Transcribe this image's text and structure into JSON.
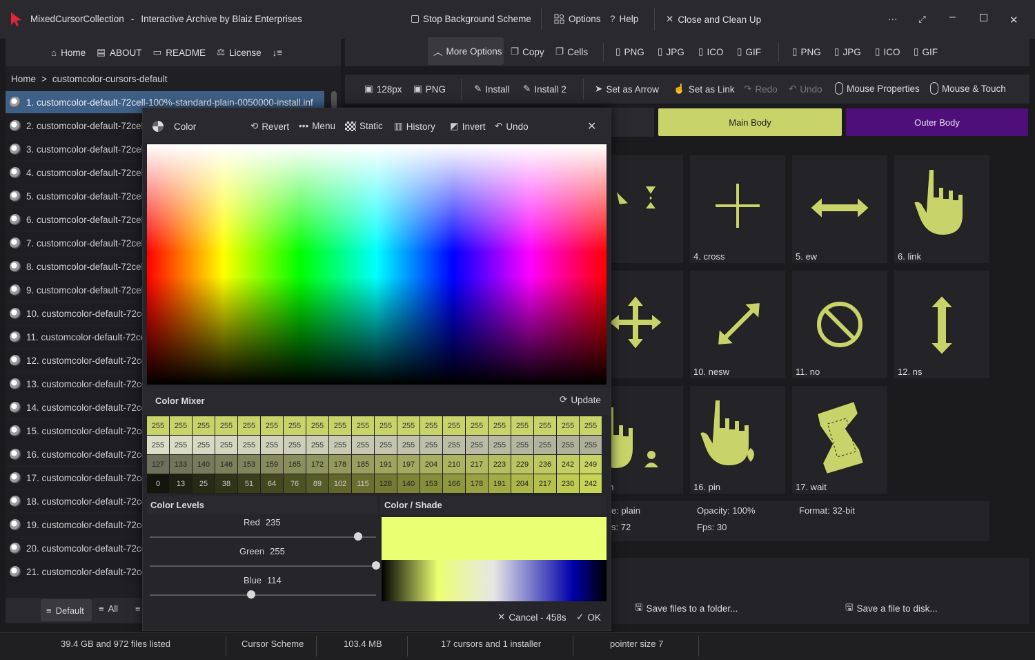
{
  "window": {
    "app_name": "MixedCursorCollection",
    "title_suffix": "Interactive Archive by Blaiz Enterprises",
    "dash": "-",
    "stop_bg": "Stop Background Scheme",
    "options": "Options",
    "help": "Help",
    "close_clean": "Close and Clean Up",
    "dots": "···"
  },
  "nav": {
    "home": "Home",
    "about": "ABOUT",
    "readme": "README",
    "license": "License",
    "sort": "↓≡"
  },
  "breadcrumb": {
    "root": "Home",
    "sep": ">",
    "current": "customcolor-cursors-default"
  },
  "list": [
    "1. customcolor-default-72cell-100%-standard-plain-0050000-install.inf",
    "2. customcolor-default-72cell-",
    "3. customcolor-default-72cell-",
    "4. customcolor-default-72cell-",
    "5. customcolor-default-72cell-",
    "6. customcolor-default-72cell-",
    "7. customcolor-default-72cell-",
    "8. customcolor-default-72cell-",
    "9. customcolor-default-72cell-",
    "10. customcolor-default-72cel",
    "11. customcolor-default-72cel",
    "12. customcolor-default-72cel",
    "13. customcolor-default-72cel",
    "14. customcolor-default-72cel",
    "15. customcolor-default-72cel",
    "16. customcolor-default-72cel",
    "17. customcolor-default-72cel",
    "18. customcolor-default-72cel",
    "19. customcolor-default-72cel",
    "20. customcolor-default-72cel",
    "21. customcolor-default-72cel"
  ],
  "list_footer": {
    "default": "Default",
    "all": "All"
  },
  "toolbar1": {
    "more_options": "More Options",
    "copy": "Copy",
    "cells": "Cells",
    "png1": "PNG",
    "jpg1": "JPG",
    "ico1": "ICO",
    "gif1": "GIF",
    "png2": "PNG",
    "jpg2": "JPG",
    "ico2": "ICO",
    "gif2": "GIF"
  },
  "toolbar2": {
    "size": "128px",
    "png": "PNG",
    "install": "Install",
    "install2": "Install 2",
    "set_arrow": "Set as Arrow",
    "set_link": "Set as Link",
    "redo": "Redo",
    "undo": "Undo",
    "mouse_props": "Mouse Properties",
    "mouse_touch": "Mouse & Touch"
  },
  "body_tabs": {
    "main": "Main Body",
    "outer": "Outer Body"
  },
  "cells": [
    {
      "label": "rk",
      "icon": "working-cursor-icon"
    },
    {
      "label": "4. cross",
      "icon": "cross-cursor-icon"
    },
    {
      "label": "5. ew",
      "icon": "ew-arrow-icon"
    },
    {
      "label": "6. link",
      "icon": "hand-link-icon"
    },
    {
      "label": "ove",
      "icon": "move-cursor-icon"
    },
    {
      "label": "10. nesw",
      "icon": "nesw-arrow-icon"
    },
    {
      "label": "11. no",
      "icon": "no-cursor-icon"
    },
    {
      "label": "12. ns",
      "icon": "ns-arrow-icon"
    },
    {
      "label": "erson",
      "icon": "person-hand-icon"
    },
    {
      "label": "16. pin",
      "icon": "pin-hand-icon"
    },
    {
      "label": "17. wait",
      "icon": "hourglass-icon"
    }
  ],
  "info": {
    "style": "e: plain",
    "size": "s: 72",
    "opacity": "Opacity: 100%",
    "fps": "Fps: 30",
    "format": "Format: 32-bit"
  },
  "save": {
    "folder": "Save files to a folder...",
    "disk": "Save a file to disk..."
  },
  "dialog": {
    "title": "Color",
    "revert": "Revert",
    "menu": "Menu",
    "static": "Static",
    "history": "History",
    "invert": "Invert",
    "undo": "Undo",
    "mixer_title": "Color Mixer",
    "update": "Update",
    "levels_title": "Color Levels",
    "shade_title": "Color / Shade",
    "red_label": "Red",
    "red": 235,
    "green_label": "Green",
    "green": 255,
    "blue_label": "Blue",
    "blue": 114,
    "cancel": "Cancel - 458s",
    "ok": "OK",
    "selected_color": "#ebff72",
    "mixer_rows": [
      [
        "255",
        "255",
        "255",
        "255",
        "255",
        "255",
        "255",
        "255",
        "255",
        "255",
        "255",
        "255",
        "255",
        "255",
        "255",
        "255",
        "255",
        "255",
        "255",
        "255"
      ],
      [
        "255",
        "255",
        "255",
        "255",
        "255",
        "255",
        "255",
        "255",
        "255",
        "255",
        "255",
        "255",
        "255",
        "255",
        "255",
        "255",
        "255",
        "255",
        "255",
        "255"
      ],
      [
        "127",
        "133",
        "140",
        "146",
        "153",
        "159",
        "165",
        "172",
        "178",
        "185",
        "191",
        "197",
        "204",
        "210",
        "217",
        "223",
        "229",
        "236",
        "242",
        "249"
      ],
      [
        "0",
        "13",
        "25",
        "38",
        "51",
        "64",
        "76",
        "89",
        "102",
        "115",
        "128",
        "140",
        "153",
        "166",
        "178",
        "191",
        "204",
        "217",
        "230",
        "242"
      ]
    ]
  },
  "status": {
    "files": "39.4 GB and 972 files listed",
    "scheme": "Cursor Scheme",
    "size": "103.4 MB",
    "count": "17 cursors and 1 installer",
    "pointer": "pointer size 7"
  }
}
